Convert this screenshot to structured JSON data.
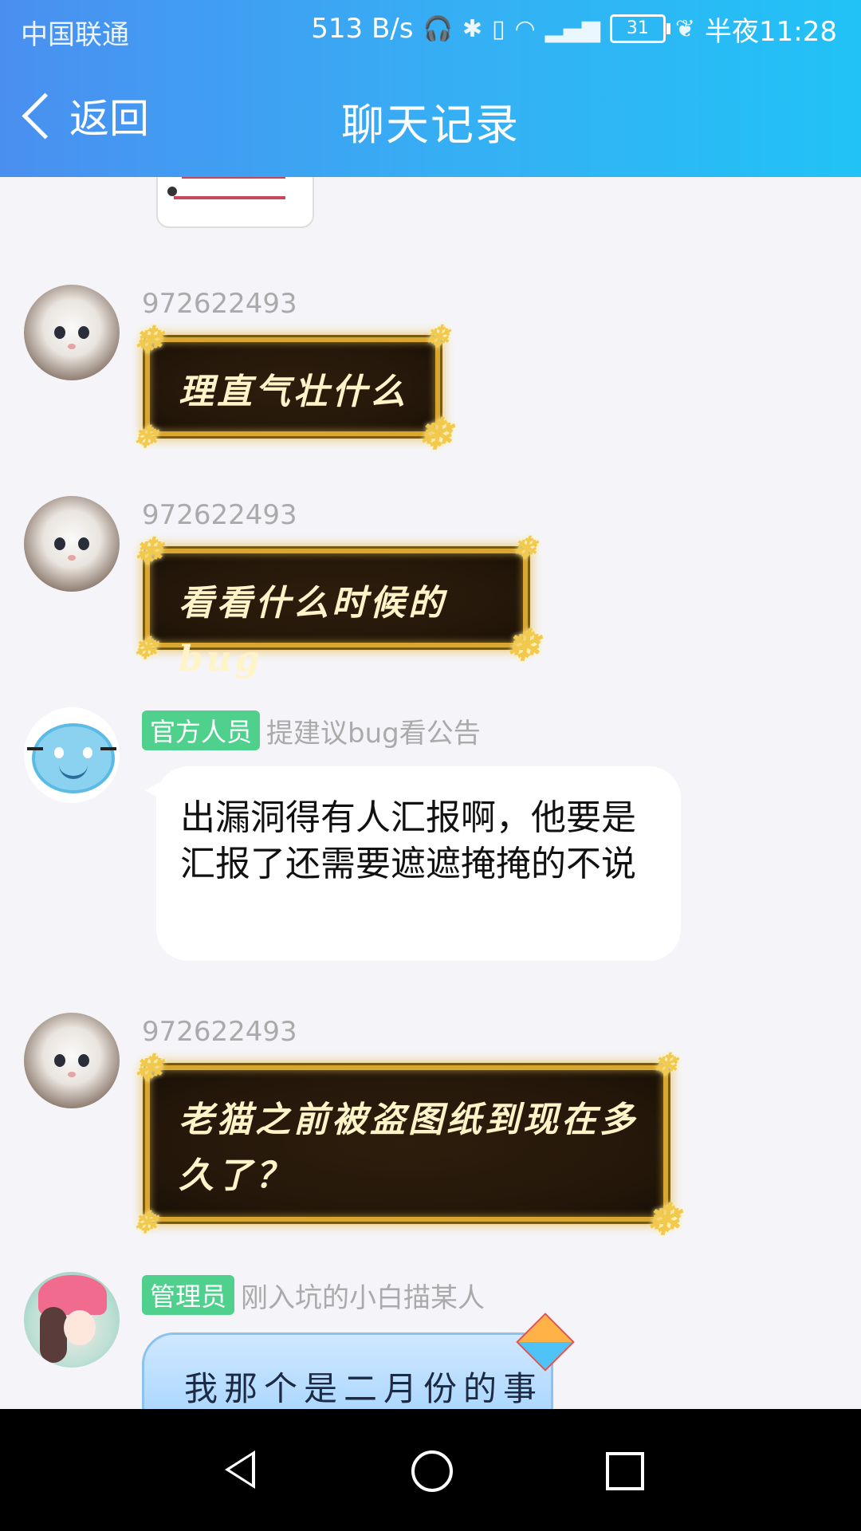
{
  "status_bar": {
    "carrier": "中国联通",
    "net_speed": "513 B/s",
    "battery": "31",
    "time": "半夜11:28",
    "icons": [
      "headphone-icon",
      "bluetooth-icon",
      "vibrate-icon",
      "wifi-icon",
      "4g-signal-icon",
      "battery-icon",
      "leaf-icon"
    ]
  },
  "header": {
    "back_label": "返回",
    "title": "聊天记录"
  },
  "messages": [
    {
      "sender": "972622493",
      "text": "理直气壮什么",
      "style": "gold-frame"
    },
    {
      "sender": "972622493",
      "text": "看看什么时候的bug",
      "style": "gold-frame"
    },
    {
      "badge": "官方人员",
      "sender": "提建议bug看公告",
      "text": "出漏洞得有人汇报啊，他要是汇报了还需要遮遮掩掩的不说",
      "style": "white"
    },
    {
      "sender": "972622493",
      "text": "老猫之前被盗图纸到现在多久了？",
      "style": "gold-frame"
    },
    {
      "badge": "管理员",
      "sender": "刚入坑的小白描某人",
      "text": "我那个是二月份的事",
      "style": "blue"
    }
  ],
  "nav_bar": {
    "icons": [
      "back-triangle-icon",
      "home-circle-icon",
      "recents-square-icon"
    ]
  },
  "colors": {
    "header_start": "#4a8ff0",
    "header_end": "#21c2f6",
    "badge": "#4fd08c",
    "gold": "#d9a62f"
  }
}
